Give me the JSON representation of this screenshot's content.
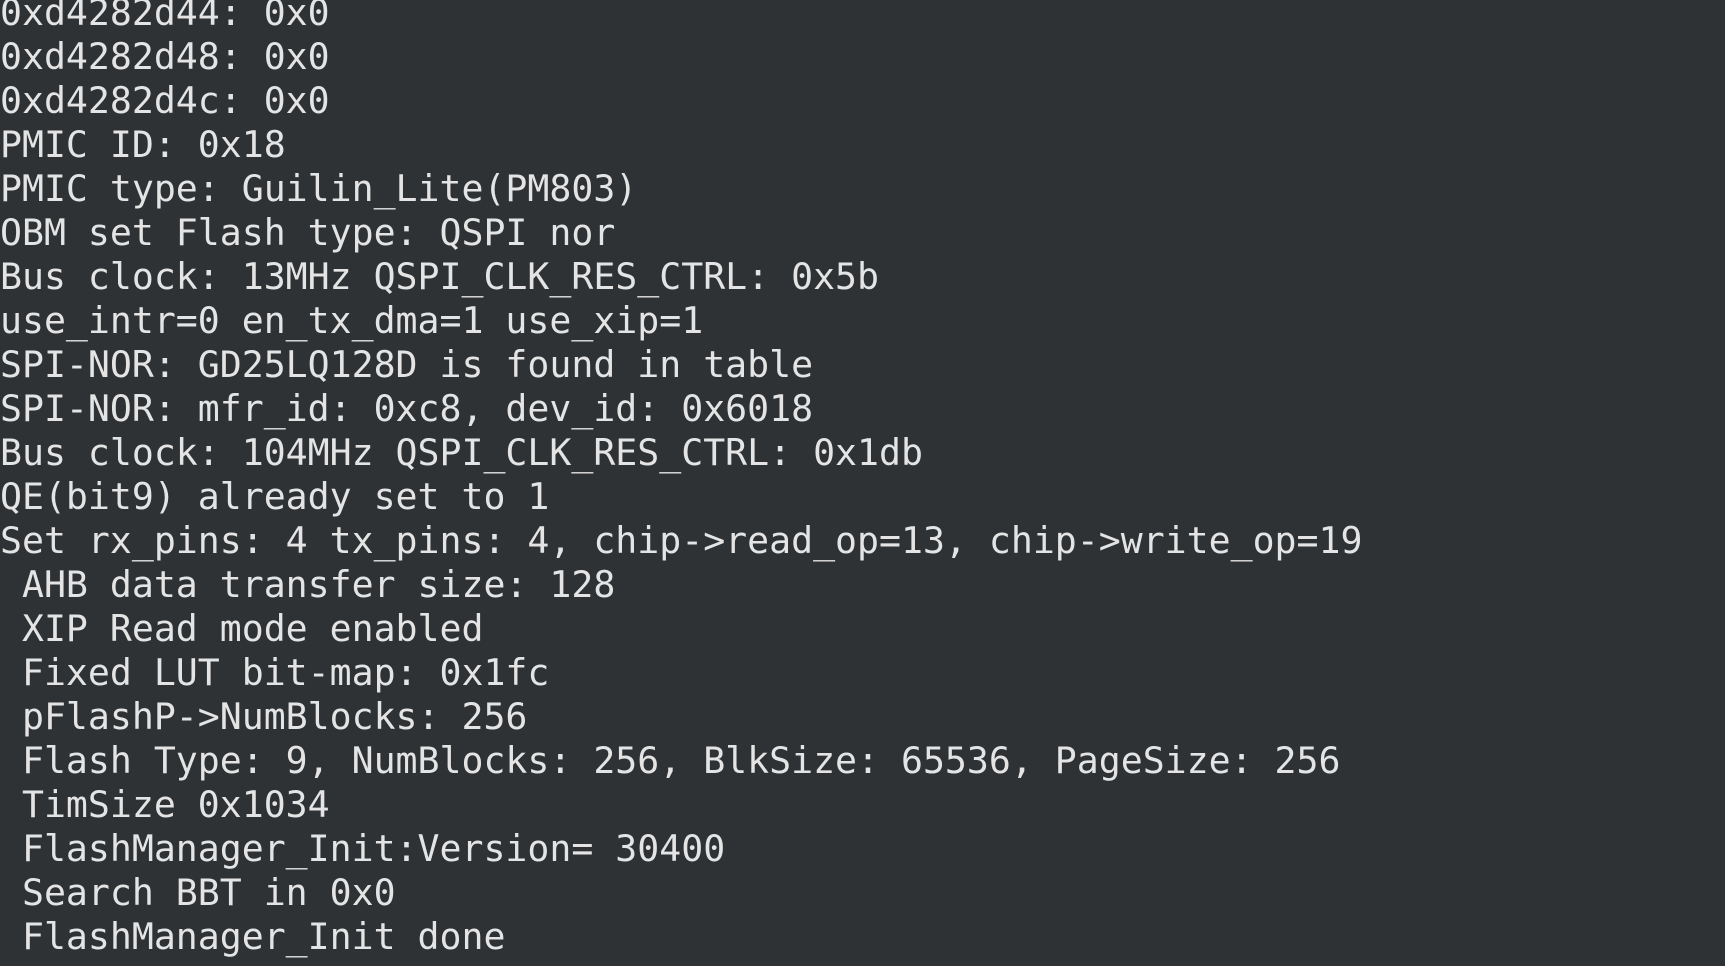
{
  "terminal": {
    "colors": {
      "background": "#2e3235",
      "foreground": "#e4e4e4"
    },
    "lines": [
      "0xd4282d44: 0x0",
      "0xd4282d48: 0x0",
      "0xd4282d4c: 0x0",
      "PMIC ID: 0x18",
      "PMIC type: Guilin_Lite(PM803)",
      "OBM set Flash type: QSPI nor",
      "Bus clock: 13MHz QSPI_CLK_RES_CTRL: 0x5b",
      "use_intr=0 en_tx_dma=1 use_xip=1",
      "SPI-NOR: GD25LQ128D is found in table",
      "SPI-NOR: mfr_id: 0xc8, dev_id: 0x6018",
      "Bus clock: 104MHz QSPI_CLK_RES_CTRL: 0x1db",
      "QE(bit9) already set to 1",
      "Set rx_pins: 4 tx_pins: 4, chip->read_op=13, chip->write_op=19",
      " AHB data transfer size: 128",
      " XIP Read mode enabled",
      " Fixed LUT bit-map: 0x1fc",
      " pFlashP->NumBlocks: 256",
      " Flash Type: 9, NumBlocks: 256, BlkSize: 65536, PageSize: 256",
      " TimSize 0x1034",
      " FlashManager_Init:Version= 30400",
      " Search BBT in 0x0",
      " FlashManager_Init done"
    ]
  }
}
